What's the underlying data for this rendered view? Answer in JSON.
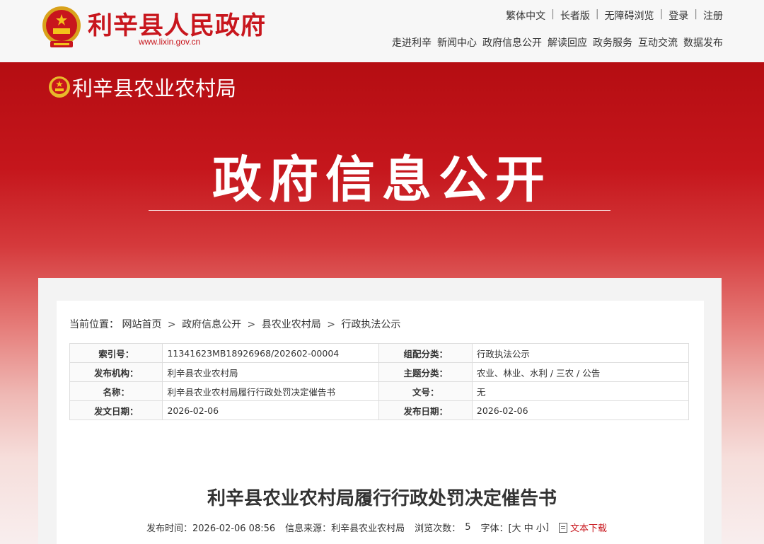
{
  "header": {
    "site_title": "利辛县人民政府",
    "site_url": "www.lixin.gov.cn",
    "util_links": [
      "繁体中文",
      "长者版",
      "无障碍浏览",
      "登录",
      "注册"
    ],
    "nav": [
      "走进利辛",
      "新闻中心",
      "政府信息公开",
      "解读回应",
      "政务服务",
      "互动交流",
      "数据发布"
    ]
  },
  "banner": {
    "dept_name": "利辛县农业农村局",
    "title": "政府信息公开"
  },
  "breadcrumb": {
    "prefix": "当前位置：",
    "items": [
      "网站首页",
      "政府信息公开",
      "县农业农村局",
      "行政执法公示"
    ],
    "separator": ">"
  },
  "meta": {
    "rows": [
      {
        "k1": "索引号：",
        "v1": "11341623MB18926968/202602-00004",
        "k2": "组配分类：",
        "v2": "行政执法公示"
      },
      {
        "k1": "发布机构：",
        "v1": "利辛县农业农村局",
        "k2": "主题分类：",
        "v2": "农业、林业、水利 / 三农 / 公告"
      },
      {
        "k1": "名称：",
        "v1": "利辛县农业农村局履行行政处罚决定催告书",
        "k2": "文号：",
        "v2": "无"
      },
      {
        "k1": "发文日期：",
        "v1": "2026-02-06",
        "k2": "发布日期：",
        "v2": "2026-02-06"
      }
    ]
  },
  "article": {
    "title": "利辛县农业农村局履行行政处罚决定催告书",
    "publish_time": "发布时间：2026-02-06 08:56",
    "source": "信息来源：利辛县农业农村局",
    "views_label": "浏览次数：",
    "views": "5",
    "font_label": "字体：[",
    "font_large": "大",
    "font_medium": "中",
    "font_small": "小",
    "font_end": "]",
    "download": "文本下载"
  },
  "colors": {
    "brand_red": "#c8161d",
    "banner_red": "#b50d12"
  }
}
